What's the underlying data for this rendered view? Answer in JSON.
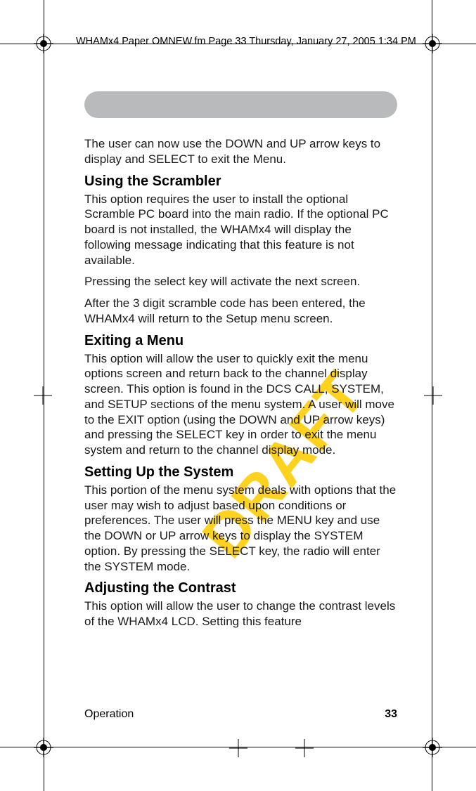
{
  "header_meta": "WHAMx4 Paper OMNEW.fm  Page 33  Thursday, January 27, 2005  1:34 PM",
  "watermark": "DRAFT",
  "paragraphs": {
    "intro": "The user can now use the DOWN and UP arrow keys to display and SELECT to exit the Menu."
  },
  "sections": [
    {
      "heading": "Using the Scrambler",
      "paras": [
        "This option requires the user to install the optional Scramble PC board into the main radio. If the optional PC board is not installed, the WHAMx4 will display the following message indicating that this feature is not available.",
        "Pressing the select key will activate the next screen.",
        "After the 3 digit scramble code has been entered, the WHAMx4 will return to the Setup menu screen."
      ]
    },
    {
      "heading": "Exiting a Menu",
      "paras": [
        "This option will allow the user to quickly exit the menu options screen and return back to the channel display screen.  This option is found in the DCS CALL, SYSTEM, and SETUP sections of the menu system.  A user will move to the EXIT option (using the DOWN and UP arrow keys) and pressing the SELECT key in order to exit the menu system and return to the channel display mode."
      ]
    },
    {
      "heading": "Setting Up the System",
      "paras": [
        "This portion of the menu system deals with options that the user may wish to adjust based upon conditions or preferences. The user will press the MENU key and use the DOWN or UP arrow keys to display the SYSTEM option. By pressing the SELECT key, the radio will enter the SYSTEM mode."
      ]
    },
    {
      "heading": "Adjusting the Contrast",
      "paras": [
        "This option will allow the user to change the contrast levels of the WHAMx4 LCD.  Setting this feature"
      ]
    }
  ],
  "footer": {
    "section_name": "Operation",
    "page_number": "33"
  }
}
